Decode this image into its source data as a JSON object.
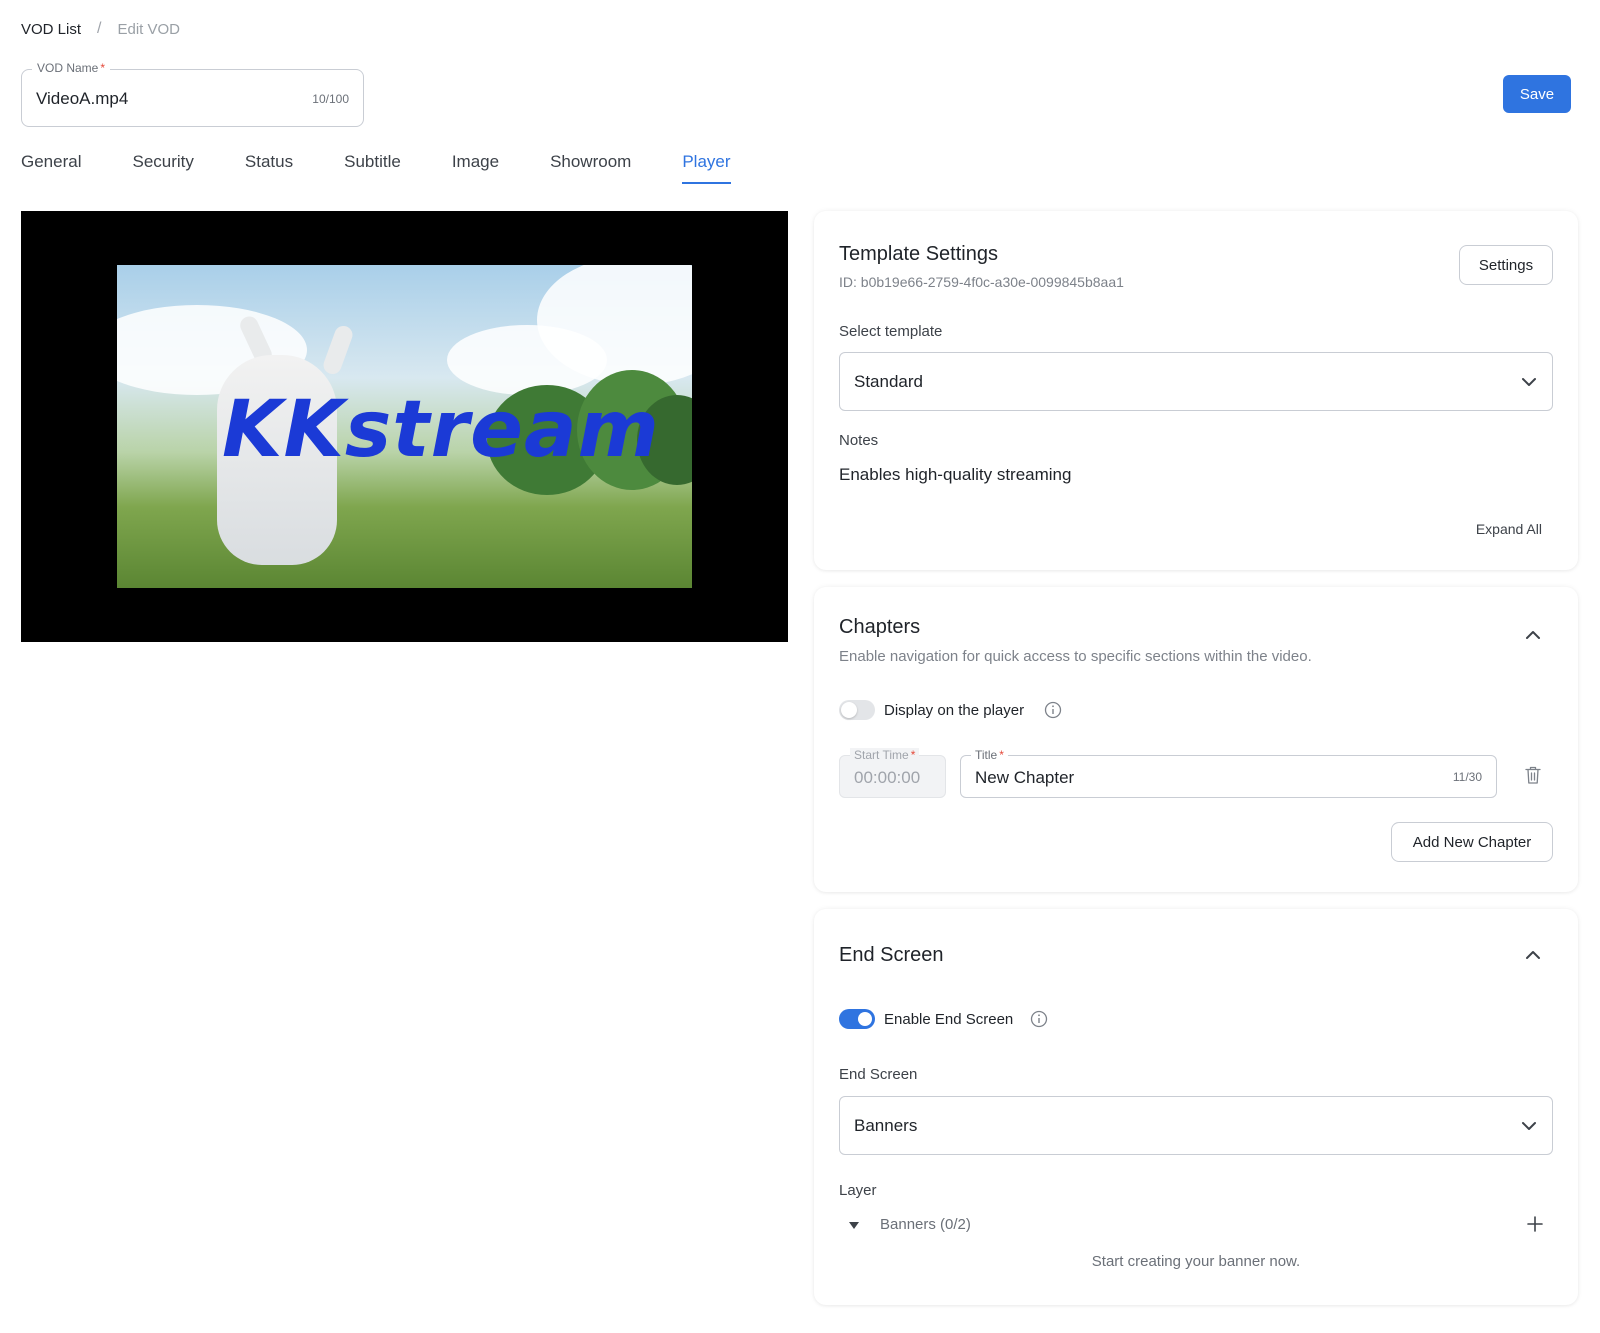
{
  "breadcrumb": {
    "parent": "VOD List",
    "separator": "/",
    "current": "Edit VOD"
  },
  "vod_name": {
    "label": "VOD Name",
    "required_mark": "*",
    "value": "VideoA.mp4",
    "count": "10/100"
  },
  "save_label": "Save",
  "tabs": [
    {
      "label": "General"
    },
    {
      "label": "Security"
    },
    {
      "label": "Status"
    },
    {
      "label": "Subtitle"
    },
    {
      "label": "Image"
    },
    {
      "label": "Showroom"
    },
    {
      "label": "Player"
    }
  ],
  "active_tab": "Player",
  "player": {
    "logo_text": "KKstream"
  },
  "template_settings": {
    "title": "Template Settings",
    "id_text": "ID: b0b19e66-2759-4f0c-a30e-0099845b8aa1",
    "settings_button": "Settings",
    "select_label": "Select template",
    "selected": "Standard",
    "notes_label": "Notes",
    "notes": "Enables high-quality streaming",
    "expand_all": "Expand All"
  },
  "chapters": {
    "title": "Chapters",
    "description": "Enable navigation for quick access to specific sections within the video.",
    "display_label": "Display on the player",
    "display_enabled": false,
    "start_time_label": "Start Time",
    "start_time_value": "00:00:00",
    "title_label": "Title",
    "title_value": "New Chapter",
    "title_count": "11/30",
    "add_button": "Add New Chapter"
  },
  "end_screen": {
    "title": "End Screen",
    "enable_label": "Enable End Screen",
    "enabled": true,
    "select_label": "End Screen",
    "selected": "Banners",
    "layer_label": "Layer",
    "layer_group": "Banners (0/2)",
    "empty_text": "Start creating your banner now."
  },
  "colors": {
    "accent": "#2f74e0",
    "required": "#e5493a",
    "border": "#c9cdd4"
  }
}
